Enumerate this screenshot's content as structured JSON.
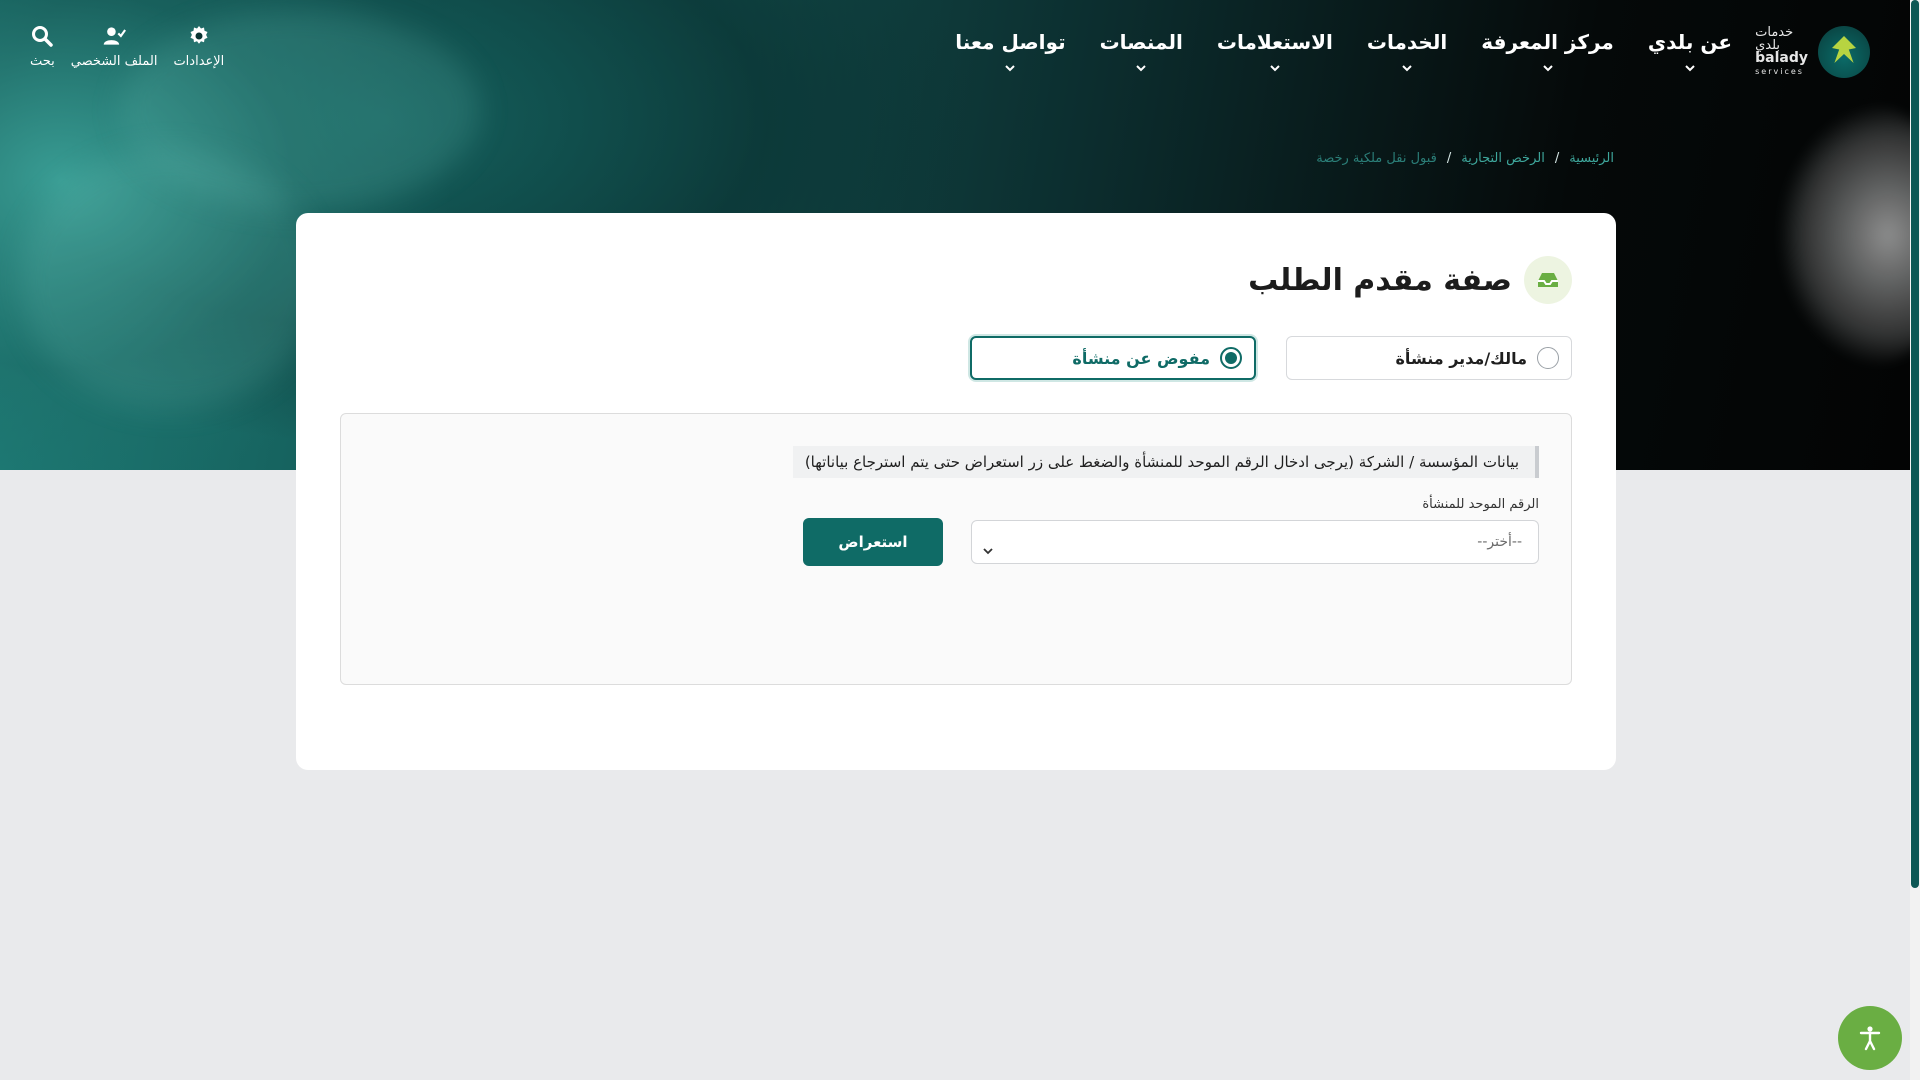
{
  "logo": {
    "arabic_top": "خدمات",
    "arabic": "بلدي",
    "english": "balady",
    "english_sub": "services"
  },
  "nav": {
    "items": [
      {
        "label": "عن بلدي"
      },
      {
        "label": "مركز المعرفة"
      },
      {
        "label": "الخدمات"
      },
      {
        "label": "الاستعلامات"
      },
      {
        "label": "المنصات"
      },
      {
        "label": "تواصل معنا"
      }
    ]
  },
  "tools": {
    "search": "بحث",
    "profile": "الملف الشخصي",
    "settings": "الإعدادات"
  },
  "breadcrumb": {
    "home": "الرئيسية",
    "section": "الرخص التجارية",
    "current": "قبول نقل ملكية رخصة",
    "separator": "/"
  },
  "form": {
    "title": "صفة مقدم الطلب",
    "options": [
      {
        "label": "مالك/مدير منشأة",
        "selected": false
      },
      {
        "label": "مفوض عن منشأة",
        "selected": true
      }
    ],
    "info_text": "بيانات المؤسسة / الشركة (يرجى ادخال الرقم الموحد للمنشأة والضغط على زر استعراض حتى يتم استرجاع بياناتها)",
    "field_label": "الرقم الموحد للمنشأة",
    "select_placeholder": "--أختر--",
    "view_button": "استعراض"
  },
  "colors": {
    "brand": "#0f6b66",
    "accent": "#6aae43",
    "link": "#3ea79c"
  }
}
